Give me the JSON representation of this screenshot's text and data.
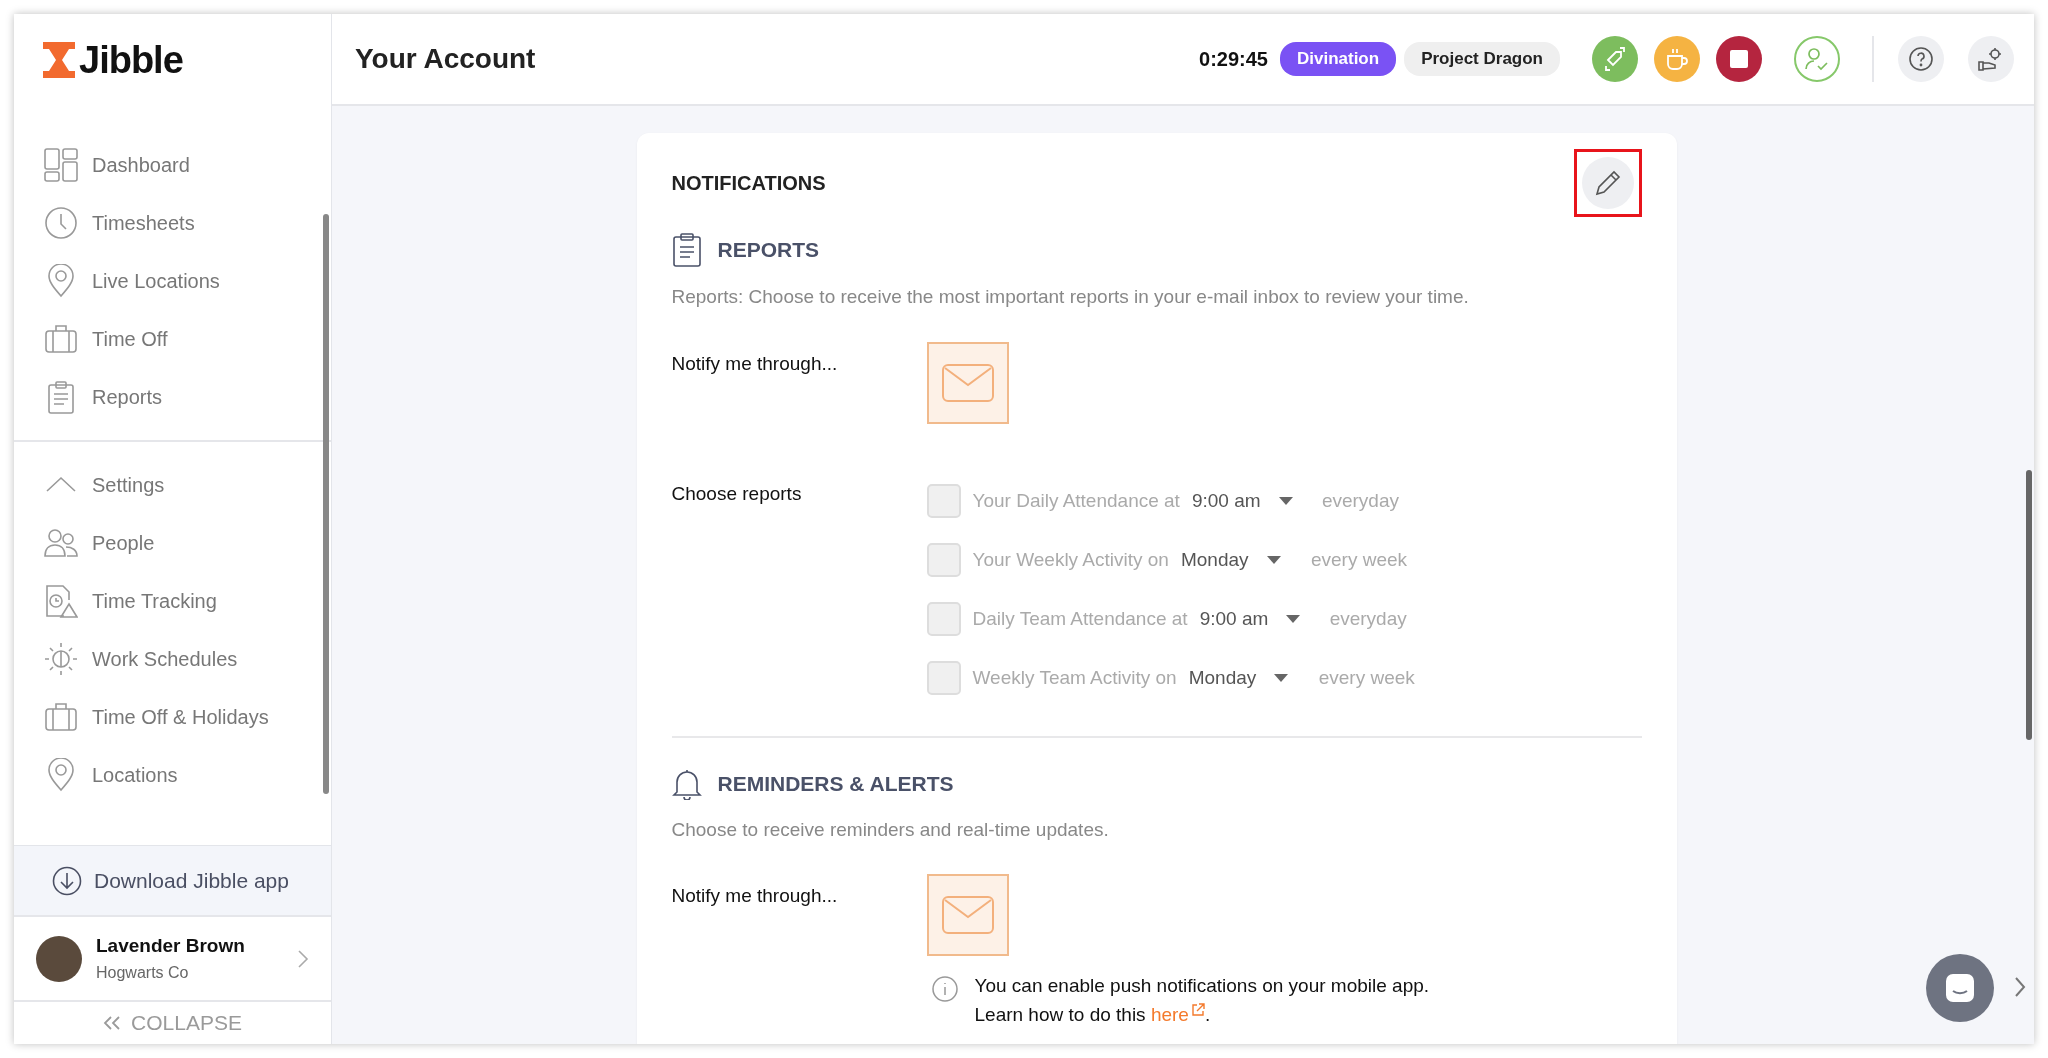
{
  "logo": {
    "text": "Jibble"
  },
  "sidebar": {
    "items": [
      {
        "label": "Dashboard",
        "selected": false
      },
      {
        "label": "Timesheets",
        "selected": false
      },
      {
        "label": "Live Locations",
        "selected": false
      },
      {
        "label": "Time Off",
        "selected": false
      },
      {
        "label": "Reports",
        "selected": false
      }
    ],
    "settings": {
      "label": "Settings",
      "expanded": true,
      "children": [
        {
          "label": "People",
          "selected": false
        },
        {
          "label": "Time Tracking",
          "selected": false
        },
        {
          "label": "Work Schedules",
          "selected": false
        },
        {
          "label": "Time Off & Holidays",
          "selected": false
        },
        {
          "label": "Locations",
          "selected": false
        }
      ]
    },
    "download": "Download Jibble app",
    "user": {
      "name": "Lavender Brown",
      "org": "Hogwarts Co"
    },
    "collapse": "COLLAPSE"
  },
  "header": {
    "title": "Your Account",
    "timer": "0:29:45",
    "activity": "Divination",
    "project": "Project Dragon"
  },
  "notifications": {
    "title": "NOTIFICATIONS",
    "edit_highlighted": true,
    "reports": {
      "title": "REPORTS",
      "description": "Reports: Choose to receive the most important reports in your e-mail inbox to review your time.",
      "notify_label": "Notify me through...",
      "email_selected": true,
      "choose_label": "Choose reports",
      "options": [
        {
          "label": "Your Daily Attendance at",
          "value": "9:00 am",
          "suffix": "everyday",
          "checked": false,
          "disabled": true
        },
        {
          "label": "Your Weekly Activity on",
          "value": "Monday",
          "suffix": "every week",
          "checked": false,
          "disabled": true
        },
        {
          "label": "Daily Team Attendance at",
          "value": "9:00 am",
          "suffix": "everyday",
          "checked": false,
          "disabled": true
        },
        {
          "label": "Weekly Team Activity on",
          "value": "Monday",
          "suffix": "every week",
          "checked": false,
          "disabled": true
        }
      ]
    },
    "reminders": {
      "title": "REMINDERS & ALERTS",
      "description": "Choose to receive reminders and real-time updates.",
      "notify_label": "Notify me through...",
      "email_selected": true,
      "info_line1": "You can enable push notifications on your mobile app.",
      "info_line2": "Learn how to do this",
      "info_link": "here",
      "info_end": "."
    }
  }
}
